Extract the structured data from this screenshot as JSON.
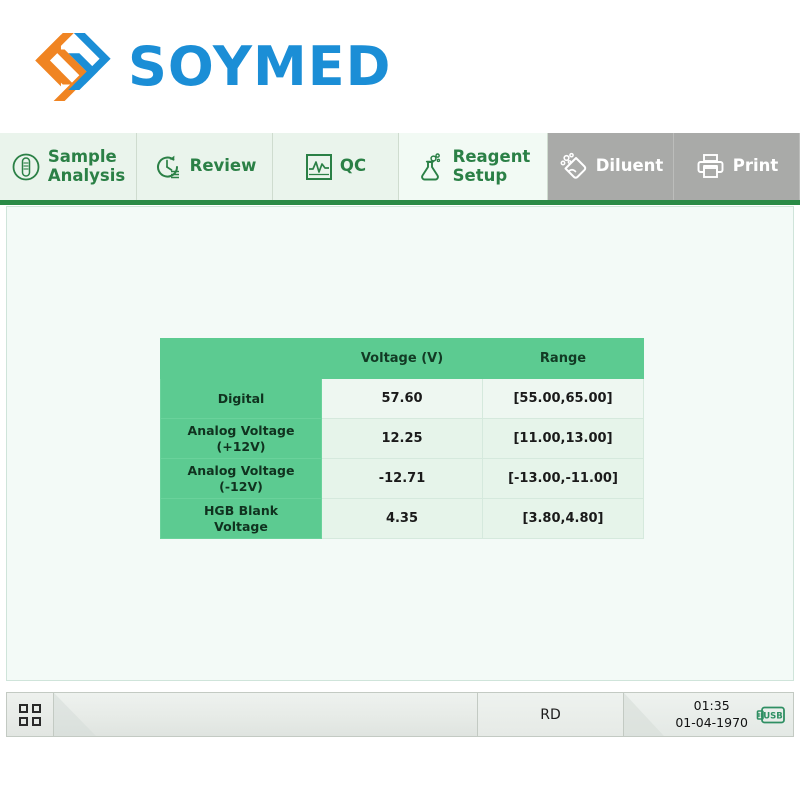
{
  "brand": {
    "name": "SOYMED",
    "mark_icon": "soymed-chevron-logo",
    "blue": "#1b8ed6",
    "orange": "#f08422"
  },
  "tabs": [
    {
      "id": "sample-analysis",
      "label": "Sample\nAnalysis",
      "icon": "test-tube-circle-icon",
      "state": "normal"
    },
    {
      "id": "review",
      "label": "Review",
      "icon": "history-clock-icon",
      "state": "normal"
    },
    {
      "id": "qc",
      "label": "QC",
      "icon": "waveform-chart-icon",
      "state": "normal"
    },
    {
      "id": "reagent-setup",
      "label": "Reagent\nSetup",
      "icon": "flask-bubbles-icon",
      "state": "active"
    },
    {
      "id": "diluent",
      "label": "Diluent",
      "icon": "diluent-drop-tag-icon",
      "state": "disabled"
    },
    {
      "id": "print",
      "label": "Print",
      "icon": "printer-icon",
      "state": "disabled"
    }
  ],
  "theme": {
    "accent_green": "#2a8a46",
    "table_header_green": "#5ccb91",
    "content_bg": "#f3faf7",
    "muted_tab": "#a9aaa8"
  },
  "table": {
    "columns": [
      "",
      "Voltage (V)",
      "Range"
    ],
    "rows": [
      {
        "label": "Digital",
        "voltage": "57.60",
        "range": "[55.00,65.00]"
      },
      {
        "label": "Analog Voltage\n(+12V)",
        "voltage": "12.25",
        "range": "[11.00,13.00]"
      },
      {
        "label": "Analog Voltage\n(-12V)",
        "voltage": "-12.71",
        "range": "[-13.00,-11.00]"
      },
      {
        "label": "HGB Blank\nVoltage",
        "voltage": "4.35",
        "range": "[3.80,4.80]"
      }
    ]
  },
  "statusbar": {
    "apps_icon": "apps-grid-icon",
    "message": "",
    "state_label": "RD",
    "time": "01:35",
    "date": "01-04-1970",
    "clock_text": "01:35\n01-04-1970",
    "usb_label": "USB",
    "usb_icon": "usb-drive-icon"
  }
}
